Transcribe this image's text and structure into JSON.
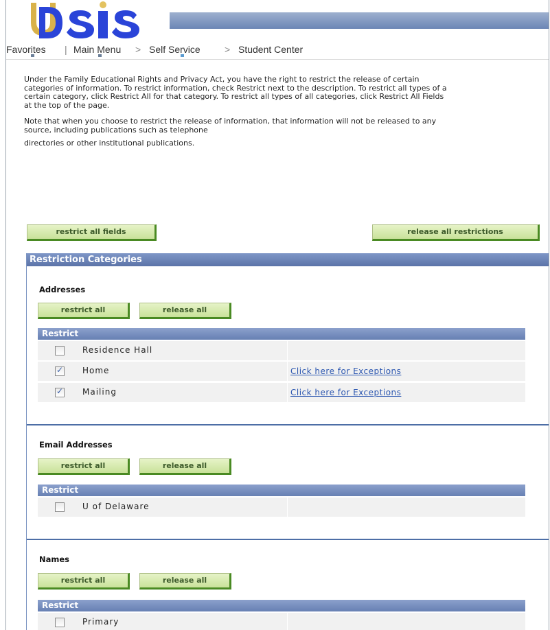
{
  "header": {
    "logo_text": "UDSIS",
    "colors": {
      "logo_blue": "#1f3fd6",
      "logo_gold": "#d9b24a",
      "header_bar": "#7b93bf"
    }
  },
  "nav": {
    "favorites": "Favorites",
    "main_menu": "Main Menu",
    "self_service": "Self Service",
    "student_center": "Student Center",
    "separator": ">"
  },
  "intro": {
    "paragraph1": "Under the Family Educational Rights and Privacy Act, you have the right to restrict the release of certain categories of information. To restrict information, check Restrict next to the description. To restrict all types of a certain category, click Restrict All for that category. To restrict all types of all categories, click Restrict All Fields at the top of the page.",
    "paragraph2": "Note that when you choose to restrict the release of information, that information will not be released to any source, including publications such as telephone",
    "paragraph3": "directories or other institutional publications."
  },
  "top_buttons": {
    "restrict_all_fields": "restrict all fields",
    "release_all_restrictions": "release all restrictions"
  },
  "panel": {
    "title": "Restriction Categories",
    "sections": [
      {
        "title": "Addresses",
        "restrict_all": "restrict all",
        "release_all": "release all",
        "grid_header": "Restrict",
        "rows": [
          {
            "label": "Residence Hall",
            "checked": false,
            "link": ""
          },
          {
            "label": "Home",
            "checked": true,
            "link": "Click here for Exceptions"
          },
          {
            "label": "Mailing",
            "checked": true,
            "link": "Click here for Exceptions"
          }
        ]
      },
      {
        "title": "Email Addresses",
        "restrict_all": "restrict all",
        "release_all": "release all",
        "grid_header": "Restrict",
        "rows": [
          {
            "label": "U of Delaware",
            "checked": false,
            "link": ""
          }
        ]
      },
      {
        "title": "Names",
        "restrict_all": "restrict all",
        "release_all": "release all",
        "grid_header": "Restrict",
        "rows": [
          {
            "label": "Primary",
            "checked": false,
            "link": ""
          }
        ]
      }
    ]
  },
  "check_mark": "✓"
}
